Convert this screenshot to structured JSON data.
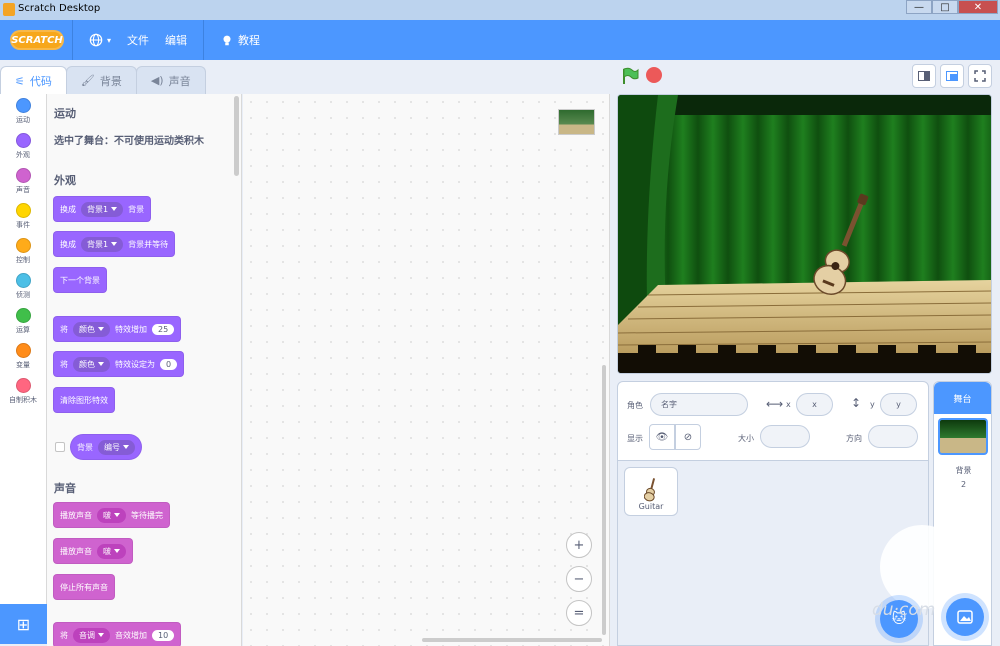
{
  "window": {
    "title": "Scratch Desktop",
    "minimize": "—",
    "maximize": "□",
    "close": "✕"
  },
  "menubar": {
    "logo": "SCRATCH",
    "file": "文件",
    "edit": "编辑",
    "tutorials": "教程"
  },
  "tabs": [
    {
      "label": "代码"
    },
    {
      "label": "背景"
    },
    {
      "label": "声音"
    }
  ],
  "categories": [
    {
      "label": "运动",
      "color": "#4c97ff"
    },
    {
      "label": "外观",
      "color": "#9966ff"
    },
    {
      "label": "声音",
      "color": "#cf63cf"
    },
    {
      "label": "事件",
      "color": "#ffd500"
    },
    {
      "label": "控制",
      "color": "#ffab19"
    },
    {
      "label": "侦测",
      "color": "#4cbfe6"
    },
    {
      "label": "运算",
      "color": "#40bf4a"
    },
    {
      "label": "变量",
      "color": "#ff8c1a"
    },
    {
      "label": "自制积木",
      "color": "#ff6680"
    }
  ],
  "palette": {
    "motion_heading": "运动",
    "motion_note": "选中了舞台：不可使用运动类积木",
    "looks_heading": "外观",
    "sound_heading": "声音",
    "blocks": {
      "switch_backdrop": {
        "a": "换成",
        "b": "背景1",
        "c": "背景"
      },
      "switch_backdrop_wait": {
        "a": "换成",
        "b": "背景1",
        "c": "背景并等待"
      },
      "next_backdrop": {
        "a": "下一个背景"
      },
      "change_effect": {
        "a": "将",
        "b": "颜色",
        "c": "特效增加",
        "d": "25"
      },
      "set_effect": {
        "a": "将",
        "b": "颜色",
        "c": "特效设定为",
        "d": "0"
      },
      "clear_effects": {
        "a": "清除图形特效"
      },
      "backdrop_number": {
        "a": "背景",
        "b": "编号"
      },
      "play_until_done": {
        "a": "播放声音",
        "b": "啵",
        "c": "等待播完"
      },
      "start_sound": {
        "a": "播放声音",
        "b": "啵"
      },
      "stop_sounds": {
        "a": "停止所有声音"
      },
      "change_pitch": {
        "a": "将",
        "b": "音调",
        "c": "音效增加",
        "d": "10"
      }
    }
  },
  "zoom": {
    "in": "+",
    "out": "−",
    "reset": "="
  },
  "sprite_info": {
    "sprite_label": "角色",
    "name_placeholder": "名字",
    "x_label": "x",
    "x_placeholder": "x",
    "y_label": "y",
    "y_placeholder": "y",
    "show_label": "显示",
    "size_label": "大小",
    "direction_label": "方向"
  },
  "sprites": [
    {
      "name": "Guitar"
    }
  ],
  "stage_panel": {
    "header": "舞台",
    "backdrops_label": "背景",
    "backdrops_count": "2"
  },
  "watermark": "du·com"
}
